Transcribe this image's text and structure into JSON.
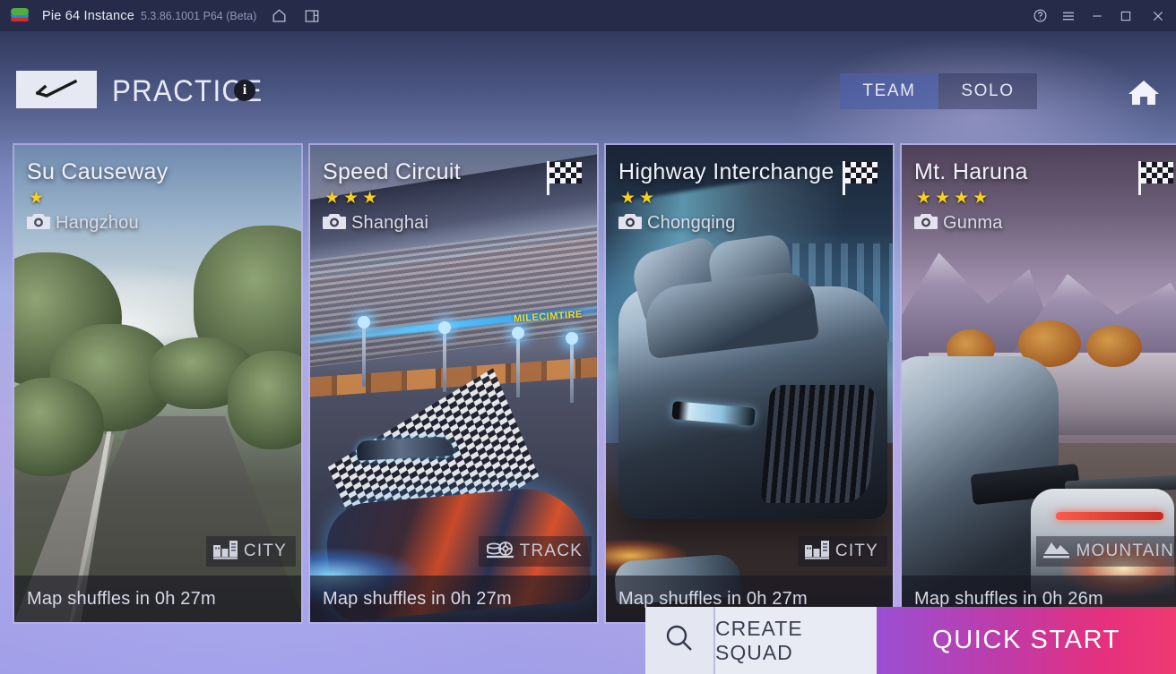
{
  "titlebar": {
    "app_name": "Pie 64 Instance",
    "version": "5.3.86.1001 P64 (Beta)",
    "icons": [
      "home-icon",
      "multi-instance-icon"
    ],
    "window_controls": [
      "help-icon",
      "menu-icon",
      "minimize-icon",
      "maximize-icon",
      "close-icon"
    ]
  },
  "header": {
    "back_label": "back-arrow",
    "title": "PRACTICE",
    "info_label": "i",
    "tabs": [
      {
        "label": "TEAM",
        "active": true
      },
      {
        "label": "SOLO",
        "active": false
      }
    ],
    "home_icon": "home-icon"
  },
  "cards": [
    {
      "title": "Su Causeway",
      "stars": 1,
      "location": "Hangzhou",
      "type": "CITY",
      "type_icon": "city-icon",
      "flag": false,
      "footer": "Map shuffles in 0h 27m"
    },
    {
      "title": "Speed Circuit",
      "stars": 3,
      "location": "Shanghai",
      "type": "TRACK",
      "type_icon": "tire-icon",
      "flag": true,
      "footer": "Map shuffles in 0h 27m",
      "ad_text": "MILECIMTIRE"
    },
    {
      "title": "Highway Interchange",
      "stars": 2,
      "location": "Chongqing",
      "type": "CITY",
      "type_icon": "city-icon",
      "flag": true,
      "footer": "Map shuffles in 0h 27m"
    },
    {
      "title": "Mt. Haruna",
      "stars": 4,
      "location": "Gunma",
      "type": "MOUNTAIN",
      "type_icon": "mountain-icon",
      "flag": true,
      "footer": "Map shuffles in 0h 26m"
    }
  ],
  "bottombar": {
    "search_icon": "search-icon",
    "create_squad_label": "CREATE SQUAD",
    "quick_start_label": "QUICK START"
  },
  "colors": {
    "titlebar_bg": "#262b4a",
    "accent_star": "#f5d01f",
    "quick_start_from": "#9b4fd4",
    "quick_start_to": "#ef3a74",
    "tab_active_bg": "#4e60a6"
  }
}
